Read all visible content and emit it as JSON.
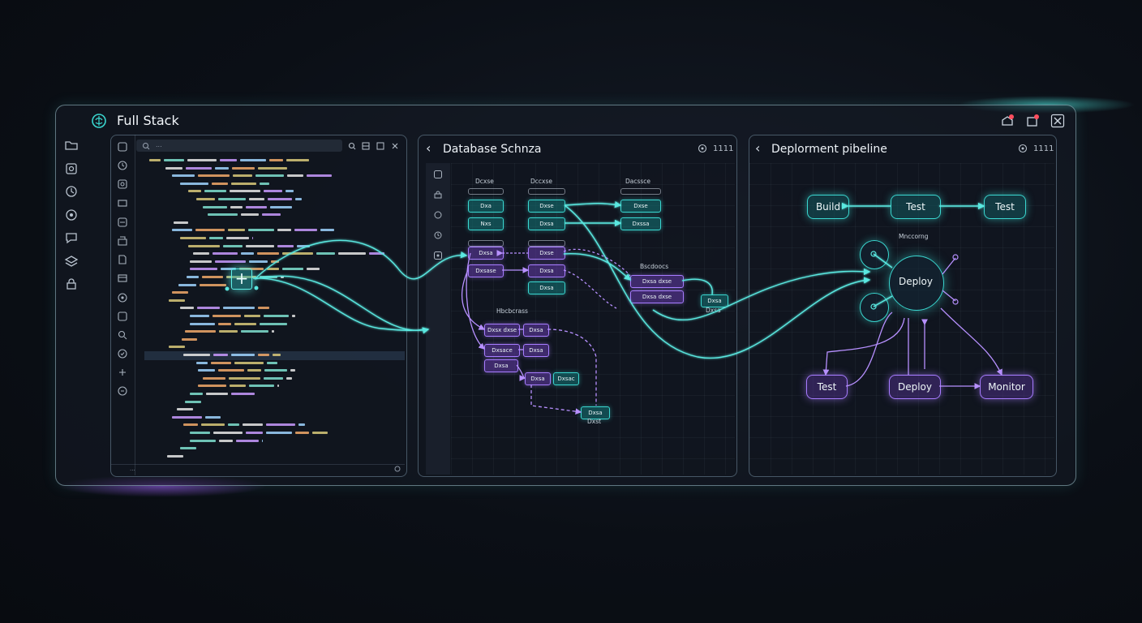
{
  "app": {
    "title": "Full Stack",
    "logo_icon": "brain-icon"
  },
  "window_controls": [
    {
      "name": "notification-icon",
      "badge": true
    },
    {
      "name": "popout-icon",
      "badge": true
    },
    {
      "name": "close-icon",
      "badge": false
    }
  ],
  "left_rail": {
    "icons": [
      "folder-icon",
      "image-icon",
      "refresh-icon",
      "settings-icon",
      "chat-icon",
      "layers-icon",
      "lock-icon"
    ]
  },
  "editor": {
    "search_text": "...",
    "rail_icons": [
      "panel-icon",
      "clock-icon",
      "image-icon",
      "monitor-icon",
      "layers-icon",
      "box-icon",
      "file-icon",
      "table-icon",
      "settings-icon",
      "refresh-icon",
      "search-icon",
      "shield-icon",
      "link-icon",
      "grid-icon"
    ],
    "toolbar_icons": [
      "search-icon",
      "split-icon",
      "copy-icon",
      "close-icon"
    ],
    "status_text": "...",
    "add_button_label": "+"
  },
  "schema": {
    "title": "Database Schnza",
    "tools": "1111",
    "rail_icons": [
      "table-icon",
      "lock-icon",
      "refresh-icon",
      "clock-icon",
      "settings-icon"
    ],
    "column_labels": {
      "c1": "Dcxse",
      "c2": "Dccxse",
      "c3": "Dacssce"
    },
    "cluster_label": "Hbcbcrass",
    "side_label": "Bscdoocs",
    "tables": {
      "t1": "Dxa",
      "t2": "Nxs",
      "t3": "Dxsase",
      "t4": "Dxse",
      "t5": "Dxsa",
      "t6": "Dxsa",
      "t7": "Dxse",
      "t8": "Dxse",
      "t9": "Dxsa",
      "t10": "Dxssa",
      "t11": "Dxsa dxse",
      "t12": "Dxsa",
      "t13": "Dxsace",
      "t14": "Dxsa",
      "t15": "Dxsa",
      "t16": "Dxsa",
      "t17": "Dxsa",
      "t18": "Dxsx dxse",
      "t19": "Dxsa dxse",
      "t20": "Dxsa",
      "t21": "Dxsac",
      "t22": "Dxsa"
    },
    "foot_label": "Dxst"
  },
  "pipeline": {
    "title": "Deplorment pibeline",
    "tools": "1111",
    "nodes": {
      "build": "Build",
      "test_center": "Test",
      "test_right": "Test",
      "deploy_circle": "Deploy",
      "test_bottom": "Test",
      "deploy_bottom": "Deploy",
      "monitor": "Monitor"
    },
    "sub_label": "Mnccorng"
  },
  "colors": {
    "teal": "#3ad7d0",
    "purple": "#a77cff",
    "background": "#0b0f16"
  }
}
